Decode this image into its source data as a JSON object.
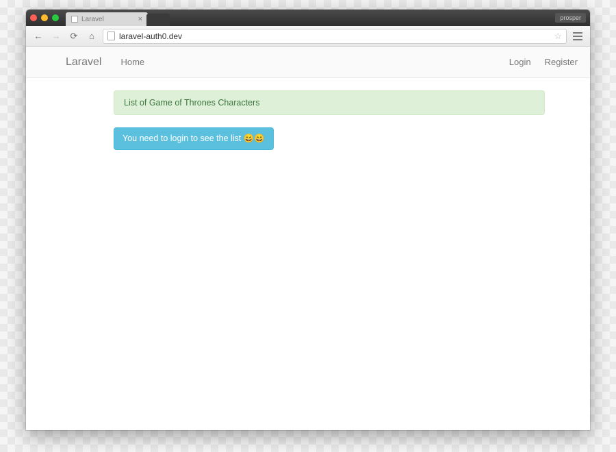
{
  "browser": {
    "tab_title": "Laravel",
    "url": "laravel-auth0.dev",
    "extension_badge": "prosper"
  },
  "navbar": {
    "brand": "Laravel",
    "left": [
      {
        "label": "Home"
      }
    ],
    "right": [
      {
        "label": "Login"
      },
      {
        "label": "Register"
      }
    ]
  },
  "content": {
    "panel_title": "List of Game of Thrones Characters",
    "login_notice": "You need to login to see the list 😄😄"
  }
}
